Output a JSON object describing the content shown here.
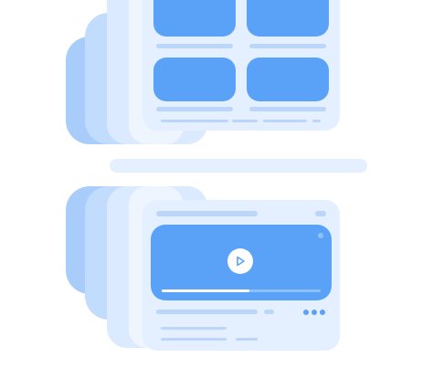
{
  "illustration": {
    "type": "stacked-ui-cards",
    "top_card": {
      "kind": "grid-gallery",
      "tiles": 4
    },
    "separator": "pill-bar",
    "bottom_card": {
      "kind": "video-player",
      "play_icon": "play-icon",
      "progress": 0.55,
      "menu_icon": "more-dots-icon",
      "status_dot": true
    }
  },
  "colors": {
    "accent": "#5aa2f8",
    "panel": "#e4efff",
    "line": "#bcd6fa",
    "stack_dark": "#a9cdfa",
    "stack_mid": "#c2dcfd",
    "stack_light": "#dbeafe"
  }
}
